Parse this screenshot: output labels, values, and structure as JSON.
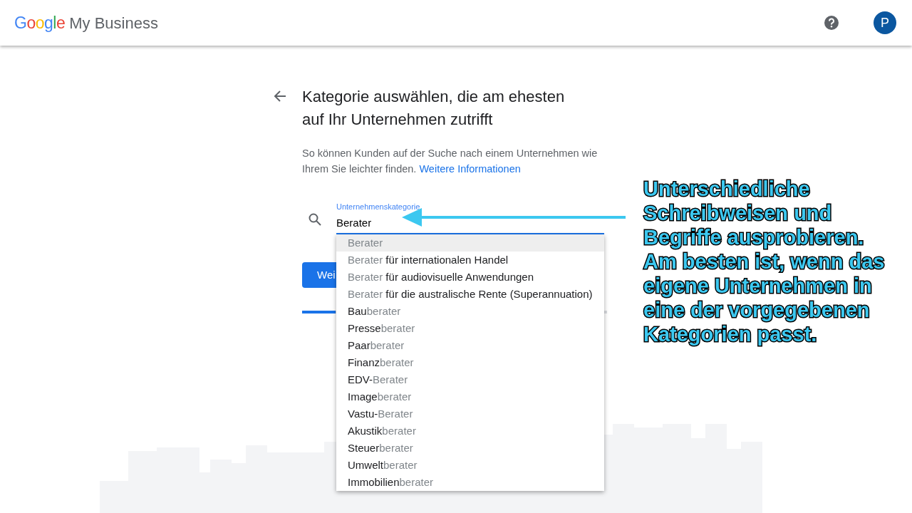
{
  "header": {
    "logo_word": "Google",
    "product": "My Business",
    "help_icon": true,
    "avatar_initial": "P"
  },
  "title": "Kategorie auswählen, die am ehesten auf Ihr Unternehmen zutrifft",
  "description": "So können Kunden auf der Suche nach einem Unternehmen wie Ihrem Sie leichter finden.",
  "link": "Weitere Informationen",
  "field": {
    "label": "Unternehmenskategorie",
    "value": "Berater",
    "focused": true
  },
  "suggestions": [
    {
      "selected": true,
      "parts": [
        {
          "text": "Berater",
          "match": true
        }
      ]
    },
    {
      "selected": false,
      "parts": [
        {
          "text": "Berater",
          "match": true
        },
        {
          "text": " für internationalen Handel",
          "match": false
        }
      ]
    },
    {
      "selected": false,
      "parts": [
        {
          "text": "Berater",
          "match": true
        },
        {
          "text": " für audiovisuelle Anwendungen",
          "match": false
        }
      ]
    },
    {
      "selected": false,
      "parts": [
        {
          "text": "Berater",
          "match": true
        },
        {
          "text": " für die australische Rente (Superannuation)",
          "match": false
        }
      ]
    },
    {
      "selected": false,
      "parts": [
        {
          "text": "Bau",
          "match": false
        },
        {
          "text": "berater",
          "match": true
        }
      ]
    },
    {
      "selected": false,
      "parts": [
        {
          "text": "Presse",
          "match": false
        },
        {
          "text": "berater",
          "match": true
        }
      ]
    },
    {
      "selected": false,
      "parts": [
        {
          "text": "Paar",
          "match": false
        },
        {
          "text": "berater",
          "match": true
        }
      ]
    },
    {
      "selected": false,
      "parts": [
        {
          "text": "Finanz",
          "match": false
        },
        {
          "text": "berater",
          "match": true
        }
      ]
    },
    {
      "selected": false,
      "parts": [
        {
          "text": "EDV-",
          "match": false
        },
        {
          "text": "Berater",
          "match": true
        }
      ]
    },
    {
      "selected": false,
      "parts": [
        {
          "text": "Image",
          "match": false
        },
        {
          "text": "berater",
          "match": true
        }
      ]
    },
    {
      "selected": false,
      "parts": [
        {
          "text": "Vastu-",
          "match": false
        },
        {
          "text": "Berater",
          "match": true
        }
      ]
    },
    {
      "selected": false,
      "parts": [
        {
          "text": "Akustik",
          "match": false
        },
        {
          "text": "berater",
          "match": true
        }
      ]
    },
    {
      "selected": false,
      "parts": [
        {
          "text": "Steuer",
          "match": false
        },
        {
          "text": "berater",
          "match": true
        }
      ]
    },
    {
      "selected": false,
      "parts": [
        {
          "text": "Umwelt",
          "match": false
        },
        {
          "text": "berater",
          "match": true
        }
      ]
    },
    {
      "selected": false,
      "parts": [
        {
          "text": "Immobilien",
          "match": false
        },
        {
          "text": "berater",
          "match": true
        }
      ]
    }
  ],
  "next_button": "Wei",
  "progress": {
    "level": 0.11
  },
  "annotation": "Unterschiedliche Schreibweisen und Begriffe ausprobieren. Am besten ist, wenn das eigene Unternehmen in eine der vorgegebenen Kategorien passt."
}
